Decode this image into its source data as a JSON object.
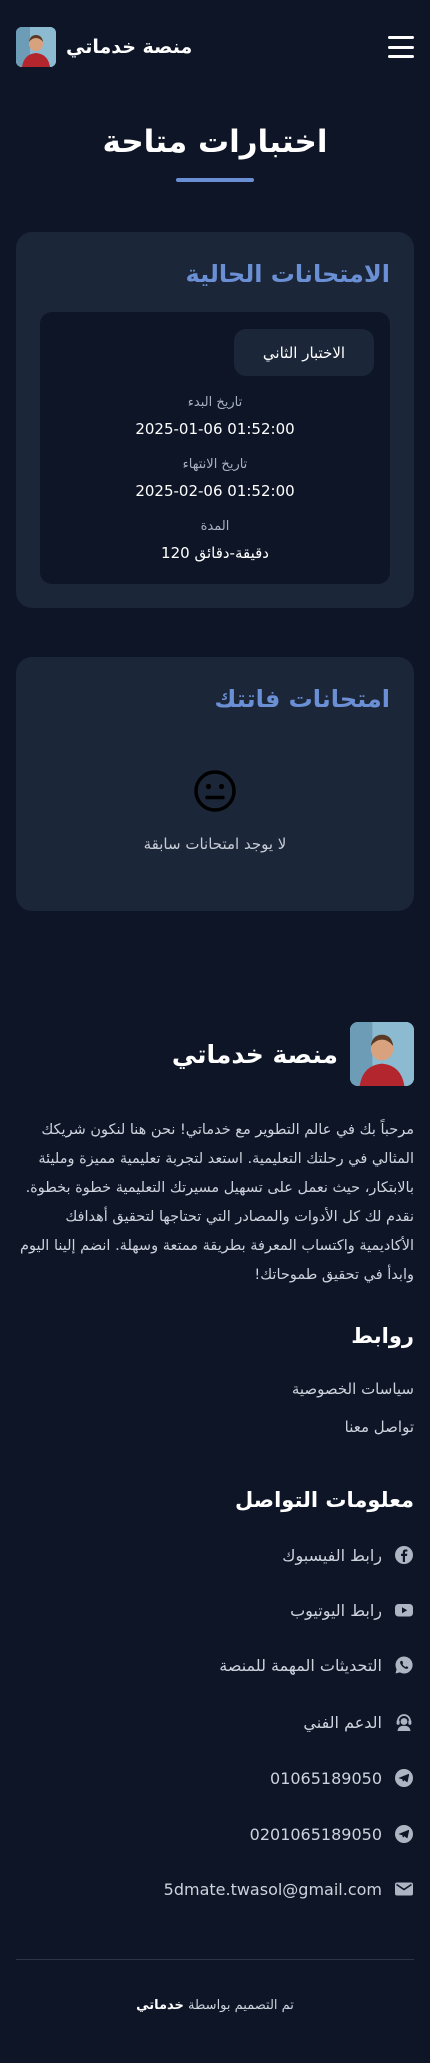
{
  "header": {
    "brand_name": "منصة خدماتي",
    "menu_icon": "hamburger-menu-icon"
  },
  "page": {
    "title": "اختبارات متاحة",
    "accent_color": "#6b8fd4"
  },
  "current_exams": {
    "heading": "الامتحانات الحالية",
    "items": [
      {
        "name": "الاختبار الثاني",
        "start_label": "تاريخ البدء",
        "start_value": "2025-01-06 01:52:00",
        "end_label": "تاريخ الانتهاء",
        "end_value": "2025-02-06 01:52:00",
        "duration_label": "المدة",
        "duration_value": "120 دقيقة-دقائق"
      }
    ]
  },
  "missed_exams": {
    "heading": "امتحانات فاتتك",
    "empty_icon": "neutral-face-icon",
    "empty_text": "لا يوجد امتحانات سابقة"
  },
  "footer": {
    "brand_name": "منصة خدماتي",
    "about": "مرحباً بك في عالم التطوير مع خدماتي! نحن هنا لنكون شريكك المثالي في رحلتك التعليمية. استعد لتجربة تعليمية مميزة ومليئة بالابتكار، حيث نعمل على تسهيل مسيرتك التعليمية خطوة بخطوة. نقدم لك كل الأدوات والمصادر التي تحتاجها لتحقيق أهدافك الأكاديمية واكتساب المعرفة بطريقة ممتعة وسهلة. انضم إلينا اليوم وابدأ في تحقيق طموحاتك!",
    "links_title": "روابط",
    "links": [
      {
        "label": "سياسات الخصوصية"
      },
      {
        "label": "تواصل معنا"
      }
    ],
    "contact_title": "معلومات التواصل",
    "contacts": [
      {
        "icon": "facebook-icon",
        "label": "رابط الفيسبوك"
      },
      {
        "icon": "youtube-icon",
        "label": "رابط اليوتيوب"
      },
      {
        "icon": "whatsapp-icon",
        "label": "التحديثات المهمة للمنصة"
      },
      {
        "icon": "support-agent-icon",
        "label": "الدعم الفني"
      },
      {
        "icon": "telegram-icon",
        "label": "01065189050"
      },
      {
        "icon": "telegram-icon",
        "label": "0201065189050"
      },
      {
        "icon": "email-icon",
        "label": "5dmate.twasol@gmail.com"
      }
    ],
    "credit_prefix": "تم التصميم بواسطة",
    "credit_name": "خدماتي"
  }
}
